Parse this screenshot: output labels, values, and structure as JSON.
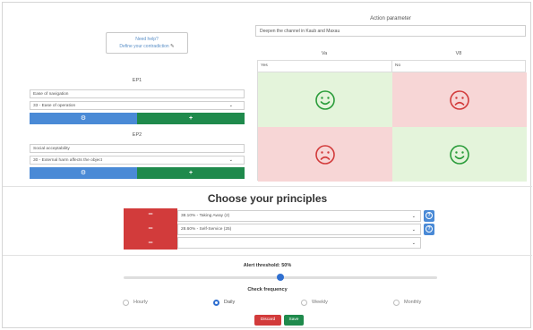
{
  "help": {
    "line1": "Need help?",
    "line2": "Define your contradiction",
    "icon": "pencil-icon"
  },
  "ep1": {
    "title": "EP1",
    "field": "Ease of navigation",
    "select": "33 - Ease of operation"
  },
  "ep2": {
    "title": "EP2",
    "field": "Social acceptability",
    "select": "30 - External harm affects the object"
  },
  "buttons": {
    "config_glyph": "⚙",
    "add_glyph": "+"
  },
  "action": {
    "title": "Action parameter",
    "value": "Deepen the channel in Kaub and Maxau",
    "col_a": "Va",
    "col_b": "V8",
    "row_a": "Yes",
    "row_b": "No"
  },
  "matrix": [
    {
      "state": "positive",
      "icon": "smiley-happy-icon"
    },
    {
      "state": "negative",
      "icon": "smiley-sad-icon"
    },
    {
      "state": "negative",
      "icon": "smiley-sad-icon"
    },
    {
      "state": "positive",
      "icon": "smiley-happy-icon"
    }
  ],
  "principles": {
    "title": "Choose your principles",
    "remove_glyph": "−",
    "items": [
      "38.10% - Taking Away (2)",
      "28.60% - Self-Service (25)",
      ""
    ]
  },
  "threshold": {
    "label": "Alert threshold: 50%",
    "value_fraction": 0.5
  },
  "frequency": {
    "label": "Check frequency",
    "options": [
      "Hourly",
      "Daily",
      "Weekly",
      "Monthly"
    ],
    "selected": "Daily"
  },
  "actions": {
    "discard": "Discard",
    "save": "Save"
  },
  "colors": {
    "accent_blue": "#4a8ad6",
    "accent_green": "#1f8a4c",
    "danger_red": "#d23b3b",
    "cell_positive": "#e4f4db",
    "cell_negative": "#f7d6d6"
  }
}
